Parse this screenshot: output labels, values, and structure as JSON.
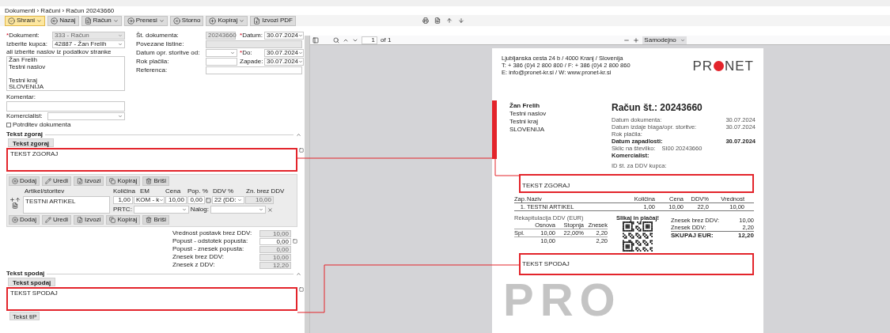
{
  "breadcrumb": "Dokumenti › Računi › Račun 20243660",
  "required_mark": "*",
  "toolbar": [
    {
      "label": "Shrani",
      "kind": "save",
      "split": true,
      "highlighted": true
    },
    {
      "label": "Nazaj",
      "kind": "back",
      "split": false,
      "highlighted": false
    },
    {
      "label": "Račun",
      "kind": "doc",
      "split": true,
      "highlighted": false
    },
    {
      "label": "Prenesi",
      "kind": "forward",
      "split": true,
      "highlighted": false
    },
    {
      "label": "Storno",
      "kind": "cancel",
      "split": false,
      "highlighted": false
    },
    {
      "label": "Kopiraj",
      "kind": "add",
      "split": true,
      "highlighted": false
    },
    {
      "label": "Izvozi PDF",
      "kind": "export",
      "split": false,
      "highlighted": false
    }
  ],
  "form": {
    "left": [
      {
        "label": "Dokument:",
        "required": true,
        "value": "333 - Račun",
        "disabled": true
      },
      {
        "label": "Izberite kupca:",
        "required": false,
        "value": "42887 - Žan Frelih",
        "disabled": false
      }
    ],
    "hint": "ali izberite naslov iz podatkov stranke",
    "address": "Žan Frelih\nTestni naslov\n\nTestni kraj\nSLOVENIJA",
    "middle": [
      {
        "label": "Št. dokumenta:",
        "kind": "short",
        "value": "20243660",
        "disabled": true,
        "date": {
          "label": "Datum:",
          "required": true,
          "value": "30.07.2024"
        }
      },
      {
        "label": "Povezane listine:",
        "kind": "wide",
        "disabled": true
      },
      {
        "label": "Datum opr. storitve od:",
        "kind": "select",
        "disabled": false,
        "date": {
          "label": "Do:",
          "required": true,
          "value": "30.07.2024"
        }
      },
      {
        "label": "Rok plačila:",
        "kind": "text",
        "disabled": false,
        "date": {
          "label": "Zapade:",
          "required": false,
          "value": "30.07.2024"
        }
      },
      {
        "label": "Referenca:",
        "kind": "wide",
        "disabled": false
      }
    ],
    "comment": {
      "label": "Komentar:"
    },
    "salesperson": {
      "label": "Komercialist:"
    },
    "confirm": {
      "label": "Potrditev dokumenta",
      "checked": false
    }
  },
  "text_top": {
    "section": "Tekst zgoraj",
    "tab": "Tekst zgoraj",
    "value": "TEKST ZGORAJ"
  },
  "items": {
    "buttons_top": [
      {
        "label": "Dodaj",
        "kind": "add"
      },
      {
        "label": "Uredi",
        "kind": "edit"
      },
      {
        "label": "Izvozi",
        "kind": "export"
      },
      {
        "label": "Kopiraj",
        "kind": "copy"
      },
      {
        "label": "Briši",
        "kind": "delete"
      }
    ],
    "columns": [
      "Artikel/storitev",
      "Količina",
      "EM",
      "Cena",
      "Pop. %",
      "DDV %",
      "Zn. brez DDV"
    ],
    "row": {
      "item": "TESTNI ARTIKEL",
      "qty": "1,00",
      "unit": "KOM - k",
      "price": "10,00",
      "discount": "0,00",
      "vat": "22 (DD:",
      "net": "10,00",
      "extra": [
        "PRTC:",
        "Nalog:"
      ]
    },
    "buttons_bottom": [
      {
        "label": "Dodaj",
        "kind": "add"
      },
      {
        "label": "Uredi",
        "kind": "edit"
      },
      {
        "label": "Izvozi",
        "kind": "export"
      },
      {
        "label": "Kopiraj",
        "kind": "copy"
      },
      {
        "label": "Briši",
        "kind": "delete"
      }
    ]
  },
  "totals": [
    {
      "label": "Vrednost postavk brez DDV:",
      "value": "10,00",
      "editable": false
    },
    {
      "label": "Popust - odstotek popusta:",
      "value": "0,00",
      "editable": true
    },
    {
      "label": "Popust - znesek popusta:",
      "value": "0,00",
      "editable": false
    },
    {
      "label": "Znesek brez DDV:",
      "value": "10,00",
      "editable": false
    },
    {
      "label": "Znesek z DDV:",
      "value": "12,20",
      "editable": false
    }
  ],
  "text_bottom": {
    "section": "Tekst spodaj",
    "tab": "Tekst spodaj",
    "value": "TEKST SPODAJ"
  },
  "bottom_button": "Tekst tiP",
  "pdf": {
    "page": "1",
    "of": "of 1",
    "zoom": "Samodejno",
    "document": {
      "sender": [
        "Ljubljanska cesta 24 b / 4000 Kranj / Slovenija",
        "T: + 386 (0)4 2 800 800 / F: + 386 (0)4 2 800 860",
        "E: info@pronet-kr.si / W: www.pronet-kr.si"
      ],
      "logo": {
        "left": "PR",
        "right": "NET"
      },
      "recipient": [
        {
          "text": "Žan Frelih",
          "bold": true
        },
        {
          "text": "Testni naslov",
          "bold": false
        },
        {
          "text": "Testni kraj",
          "bold": false
        },
        {
          "text": "SLOVENIJA",
          "bold": false
        }
      ],
      "title": "Račun št.: 20243660",
      "details": [
        {
          "label": "Datum dokumenta:",
          "value": "30.07.2024",
          "bold": false
        },
        {
          "label": "Datum izdaje blaga/opr. storitve:",
          "value": "30.07.2024",
          "bold": false
        },
        {
          "label": "Rok plačila:",
          "bold": false
        },
        {
          "label": "Datum zapadlosti:",
          "value": "30.07.2024",
          "bold": true
        },
        {
          "label": "Sklic na številko:",
          "reference": "SI00 20243660",
          "bold": false
        },
        {
          "label": "Komercialist:",
          "bold": true
        }
      ],
      "vat_id": "ID št. za DDV kupca:",
      "text_top": "TEKST ZGORAJ",
      "columns": [
        "Zap.",
        "Naziv",
        "Količina",
        "Cena",
        "DDV%",
        "Vrednost"
      ],
      "rows": [
        [
          "1.",
          "TESTNI ARTIKEL",
          "1,00",
          "10,00",
          "22,0",
          "10,00"
        ]
      ],
      "vat": {
        "title": "Rekapitulacija DDV (EUR)",
        "columns": [
          null,
          "Osnova",
          "Stopnja",
          "Znesek"
        ],
        "rows": [
          [
            "Spl.",
            "10,00",
            "22,00%",
            "2,20"
          ]
        ],
        "total": {
          "base": "10,00",
          "amount": "2,20"
        }
      },
      "qr_label": "Slikaj in plačaj!",
      "totals": [
        {
          "label": "Znesek brez DDV:",
          "value": "10,00",
          "bold": false
        },
        {
          "label": "Znesek DDV:",
          "value": "2,20",
          "bold": false
        },
        {
          "label": "SKUPAJ EUR:",
          "value": "12,20",
          "bold": true
        }
      ],
      "text_bottom": "TEKST SPODAJ",
      "watermark": "PRO"
    }
  }
}
